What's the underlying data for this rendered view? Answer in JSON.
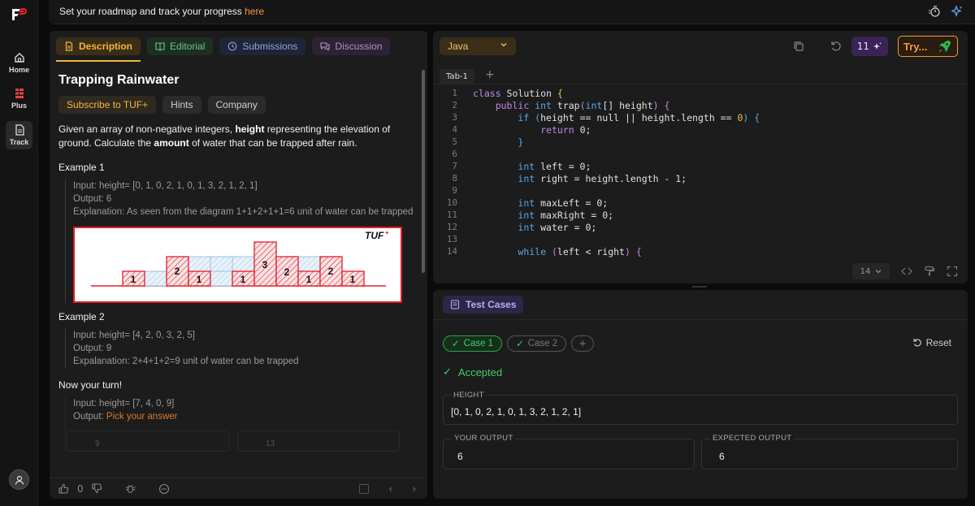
{
  "sidebar": {
    "items": [
      {
        "label": "Home",
        "icon": "home-icon"
      },
      {
        "label": "Plus",
        "icon": "plus-grid-icon"
      },
      {
        "label": "Track",
        "icon": "document-icon"
      }
    ]
  },
  "topbar": {
    "message": "Set your roadmap and track your progress",
    "link": "here"
  },
  "left": {
    "tabs": [
      "Description",
      "Editorial",
      "Submissions",
      "Discussion"
    ],
    "title": "Trapping Rainwater",
    "chips": [
      "Subscribe to TUF+",
      "Hints",
      "Company"
    ],
    "description": {
      "p1": "Given an array of non-negative integers, ",
      "b1": "height",
      "p2": " representing the elevation of ground. Calculate the ",
      "b2": "amount",
      "p3": " of water that can be trapped after rain."
    },
    "example1": {
      "heading": "Example 1",
      "input": "Input: height= [0, 1, 0, 2, 1, 0, 1, 3, 2, 1, 2, 1]",
      "output": "Output: 6",
      "explanation": "Explanation: As seen from the diagram 1+1+2+1+1=6 unit of water can be trapped"
    },
    "diagram": {
      "brand": "TUF",
      "bar_labels": [
        "1",
        "2",
        "1",
        "1",
        "3",
        "2",
        "1",
        "2",
        "1"
      ]
    },
    "example2": {
      "heading": "Example 2",
      "input": "Input: height= [4, 2, 0, 3, 2, 5]",
      "output": "Output: 9",
      "explanation": "Expalanation: 2+4+1+2=9 unit of water can be trapped"
    },
    "turn": {
      "heading": "Now your turn!",
      "input": "Input: height= [7, 4, 0, 9]",
      "output_label": "Output:",
      "output_prompt": "Pick your answer",
      "options": [
        "9",
        "13"
      ]
    },
    "footer": {
      "likes": "0"
    }
  },
  "editor": {
    "language": "Java",
    "badge_count": "11",
    "try_label": "Try...",
    "tab": "Tab-1",
    "font_size": "14",
    "lines": [
      {
        "n": "1",
        "code": "class Solution {"
      },
      {
        "n": "2",
        "code": "    public int trap(int[] height) {"
      },
      {
        "n": "3",
        "code": "        if (height == null || height.length == 0) {"
      },
      {
        "n": "4",
        "code": "            return 0;"
      },
      {
        "n": "5",
        "code": "        }"
      },
      {
        "n": "6",
        "code": ""
      },
      {
        "n": "7",
        "code": "        int left = 0;"
      },
      {
        "n": "8",
        "code": "        int right = height.length - 1;"
      },
      {
        "n": "9",
        "code": ""
      },
      {
        "n": "10",
        "code": "        int maxLeft = 0;"
      },
      {
        "n": "11",
        "code": "        int maxRight = 0;"
      },
      {
        "n": "12",
        "code": "        int water = 0;"
      },
      {
        "n": "13",
        "code": ""
      },
      {
        "n": "14",
        "code": "        while (left < right) {"
      }
    ]
  },
  "tests": {
    "header": "Test Cases",
    "cases": [
      "Case 1",
      "Case 2"
    ],
    "reset": "Reset",
    "status": "Accepted",
    "height_label": "HEIGHT",
    "height_value": "[0, 1, 0, 2, 1, 0, 1, 3, 2, 1, 2, 1]",
    "your_output_label": "YOUR OUTPUT",
    "your_output": "6",
    "expected_label": "EXPECTED OUTPUT",
    "expected": "6"
  },
  "colors": {
    "accent": "#f5b53c",
    "success": "#3fcf6c",
    "brand_red": "#e21d2a"
  }
}
